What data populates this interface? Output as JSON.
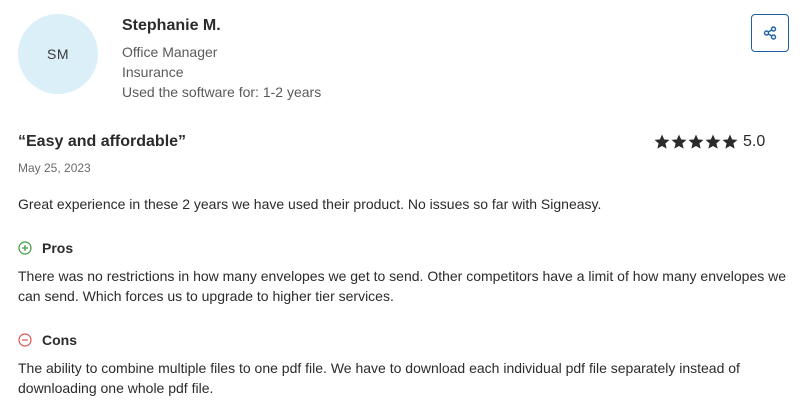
{
  "reviewer": {
    "initials": "SM",
    "name": "Stephanie M.",
    "role": "Office Manager",
    "industry": "Insurance",
    "usage": "Used the software for: 1-2 years"
  },
  "share": {
    "icon": "share-icon"
  },
  "review": {
    "title": "“Easy and affordable”",
    "date": "May 25, 2023",
    "rating": 5,
    "rating_label": "5.0",
    "summary": "Great experience in these 2 years we have used their product. No issues so far with Signeasy.",
    "pros_label": "Pros",
    "pros_text": "There was no restrictions in how many envelopes we get to send. Other competitors have a limit of how many envelopes we can send. Which forces us to upgrade to higher tier services.",
    "cons_label": "Cons",
    "cons_text": "The ability to combine multiple files to one pdf file. We have to download each individual pdf file separately instead of downloading one whole pdf file."
  },
  "colors": {
    "avatar_bg": "#dbeff9",
    "accent": "#1d5fa8",
    "pros_icon": "#3a9a3a",
    "cons_icon": "#d9534f",
    "star": "#2b2b2b"
  }
}
